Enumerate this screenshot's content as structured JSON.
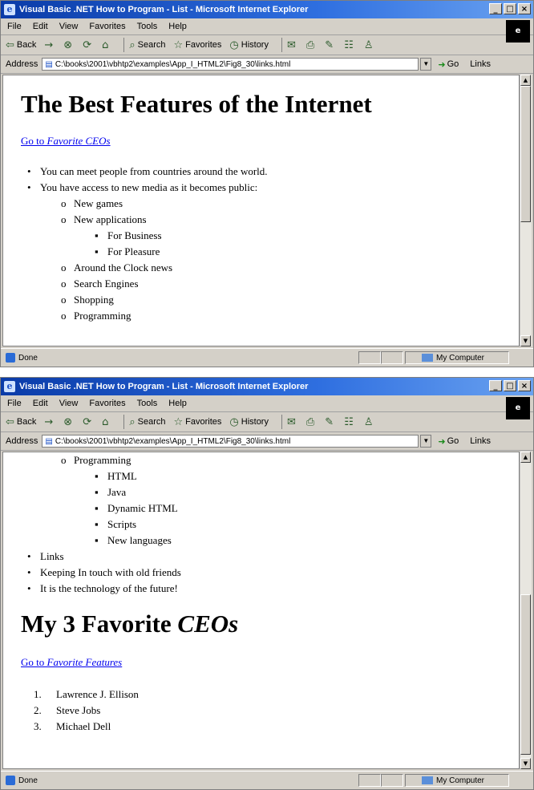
{
  "window": {
    "title": "Visual Basic .NET How to Program - List - Microsoft Internet Explorer",
    "controls": {
      "minimize": "_",
      "maximize": "□",
      "close": "×"
    },
    "throbber": "e"
  },
  "menu": [
    "File",
    "Edit",
    "View",
    "Favorites",
    "Tools",
    "Help"
  ],
  "toolbar": {
    "back": "Back",
    "forward": "→",
    "search": "Search",
    "favorites": "Favorites",
    "history": "History"
  },
  "address": {
    "label": "Address",
    "url": "C:\\books\\2001\\vbhtp2\\examples\\App_I_HTML2\\Fig8_30\\links.html",
    "go": "Go",
    "links": "Links"
  },
  "status": {
    "text": "Done",
    "zone": "My Computer"
  },
  "screen1": {
    "heading": "The Best Features of the Internet",
    "link_prefix": "Go to ",
    "link_em": "Favorite CEOs",
    "items": [
      {
        "text": "You can meet people from countries around the world.",
        "marker": "•"
      },
      {
        "text": "You have access to new media as it becomes public:",
        "marker": "•"
      },
      {
        "text": "New games",
        "marker": "o"
      },
      {
        "text": "New applications",
        "marker": "o"
      },
      {
        "text": "For Business",
        "marker": "▪"
      },
      {
        "text": "For Pleasure",
        "marker": "▪"
      },
      {
        "text": "Around the Clock news",
        "marker": "o"
      },
      {
        "text": "Search Engines",
        "marker": "o"
      },
      {
        "text": "Shopping",
        "marker": "o"
      },
      {
        "text": "Programming",
        "marker": "o"
      }
    ]
  },
  "screen2": {
    "items": [
      {
        "text": "Programming",
        "marker": "o"
      },
      {
        "text": "HTML",
        "marker": "▪"
      },
      {
        "text": "Java",
        "marker": "▪"
      },
      {
        "text": "Dynamic HTML",
        "marker": "▪"
      },
      {
        "text": "Scripts",
        "marker": "▪"
      },
      {
        "text": "New languages",
        "marker": "▪"
      },
      {
        "text": "Links",
        "marker": "•"
      },
      {
        "text": "Keeping In touch with old friends",
        "marker": "•"
      },
      {
        "text": "It is the technology of the future!",
        "marker": "•"
      }
    ],
    "heading_prefix": "My 3 Favorite ",
    "heading_em": "CEOs",
    "link_prefix": "Go to ",
    "link_em": "Favorite Features",
    "ceos": [
      {
        "num": "1.",
        "name": "Lawrence J. Ellison"
      },
      {
        "num": "2.",
        "name": "Steve Jobs"
      },
      {
        "num": "3.",
        "name": "Michael Dell"
      }
    ]
  }
}
